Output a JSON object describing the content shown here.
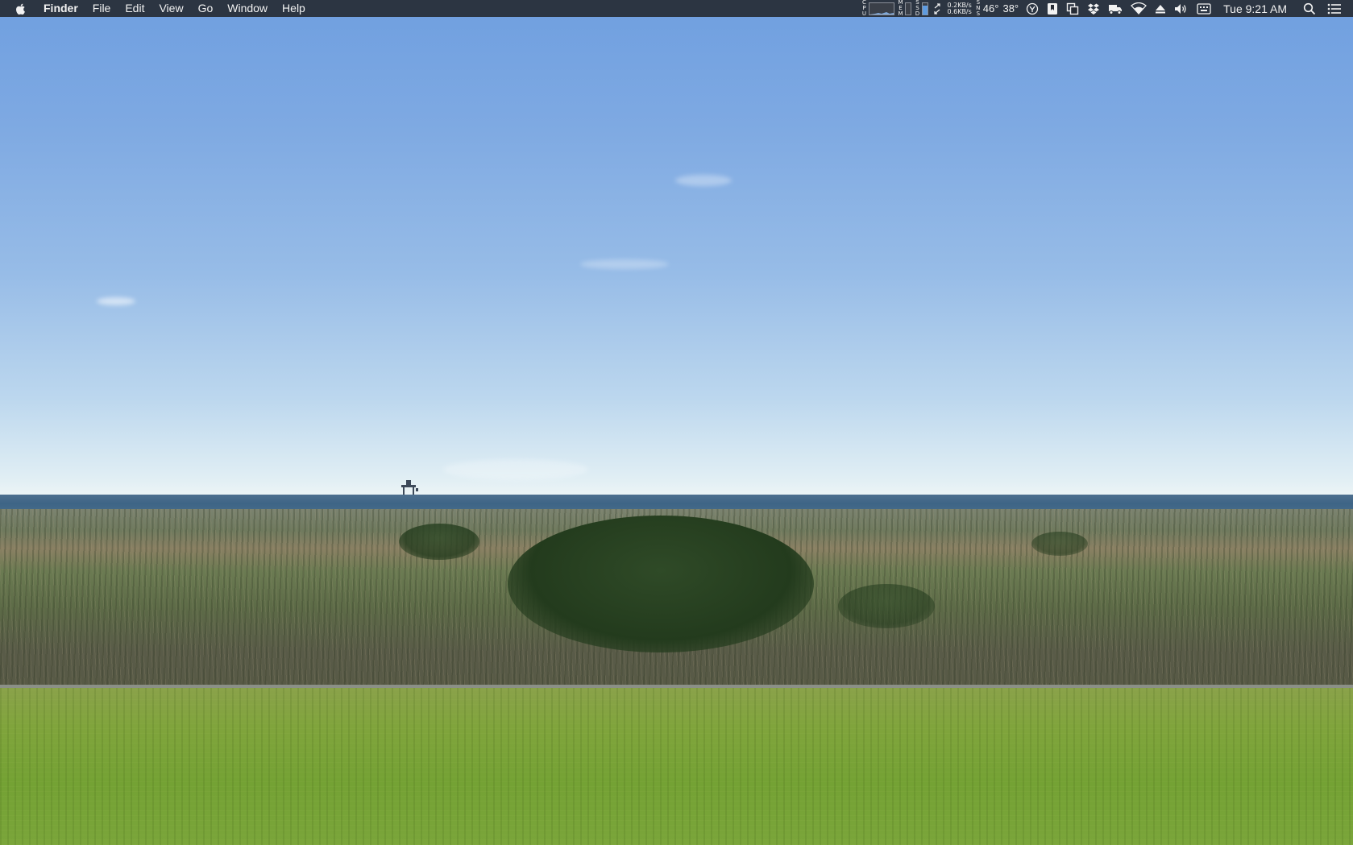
{
  "menubar": {
    "apple_icon": "apple-logo-icon",
    "app_name": "Finder",
    "menus": [
      "File",
      "Edit",
      "View",
      "Go",
      "Window",
      "Help"
    ],
    "status": {
      "cpu_label": "CPU",
      "mem_label": "MEM",
      "ssd_label": "SSD",
      "net_up": "0.2KB/s",
      "net_down": "0.6KB/s",
      "sensor_label": "SNS",
      "temp_1": "46°",
      "temp_2": "38°",
      "clock": "Tue 9:21 AM"
    }
  },
  "desktop": {
    "wallpaper": "coastal dunes landscape",
    "colors": {
      "menubar_bg": "#262b34",
      "sky_top": "#6f9fe0",
      "sea": "#3e6586",
      "lawn": "#7aa53a"
    }
  }
}
